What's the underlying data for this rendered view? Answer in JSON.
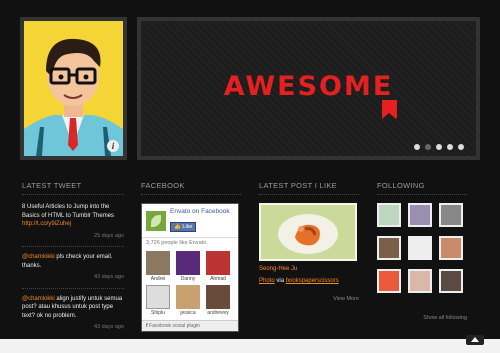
{
  "slider": {
    "headline": "AWESOME",
    "dots": 5,
    "active_dot": 1
  },
  "columns": {
    "tweets_title": "Latest Tweet",
    "facebook_title": "Facebook",
    "post_title": "Latest Post I Like",
    "following_title": "Following"
  },
  "tweets": [
    {
      "text": "8 Useful Articles to Jump into the Basics of HTML to Tumblr Themes",
      "link": "http://t.co/y9iZuhej",
      "time": "25 days ago"
    },
    {
      "mention": "@chamlokki",
      "text": " pls check your email. thanks.",
      "time": "43 days ago"
    },
    {
      "mention": "@chamlokki",
      "text": " align justify untuk semua post? atau khusus untuk post type text? ok no problem.",
      "time": "43 days ago"
    }
  ],
  "facebook": {
    "page_name": "Envato",
    "on_label": "on Facebook",
    "like_label": "Like",
    "count_text": "3,726 people like Envato.",
    "people": [
      {
        "name": "Andrei",
        "color": "#8a7860"
      },
      {
        "name": "Danny",
        "color": "#5a2a7a"
      },
      {
        "name": "Ahmad",
        "color": "#b33"
      },
      {
        "name": "Shiplu",
        "color": "#ddd"
      },
      {
        "name": "jessica",
        "color": "#c9a070"
      },
      {
        "name": "andrewvy",
        "color": "#6a4a3a"
      }
    ],
    "footer": "Facebook social plugin"
  },
  "post": {
    "author": "Seong-Hee Ju",
    "photo_label": "Photo",
    "via_label": "via",
    "source": "bookspaperscissors",
    "view_more": "View More"
  },
  "following": {
    "thumbs": [
      "#bcd6c0",
      "#9a8fb0",
      "#888",
      "#7a6048",
      "#eee",
      "#c98a6a",
      "#e85a3a",
      "#d9b8a8",
      "#5a4a40"
    ],
    "show_all": "Show all following"
  },
  "colors": {
    "accent": "#f58b1f",
    "headline": "#e42020"
  }
}
